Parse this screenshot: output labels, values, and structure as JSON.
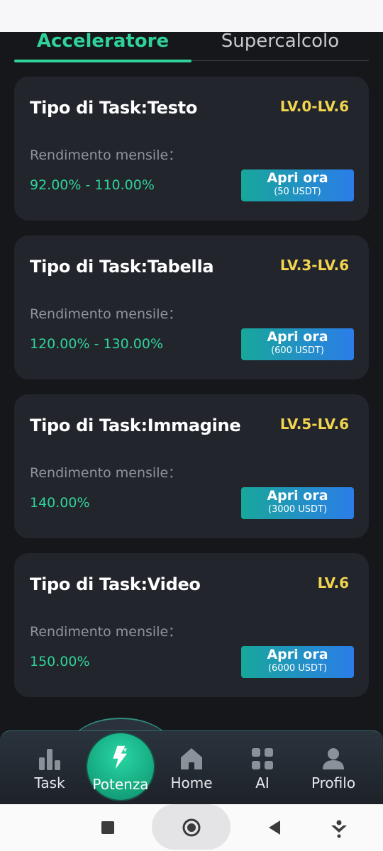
{
  "tabs": [
    {
      "label": "Acceleratore",
      "active": true
    },
    {
      "label": "Supercalcolo",
      "active": false
    }
  ],
  "cards": [
    {
      "title": "Tipo di Task:Testo",
      "level": "LV.0-LV.6",
      "label": "Rendimento mensile：",
      "yield": "92.00% - 110.00%",
      "button": "Apri ora",
      "price": "(50 USDT)"
    },
    {
      "title": "Tipo di Task:Tabella",
      "level": "LV.3-LV.6",
      "label": "Rendimento mensile：",
      "yield": "120.00% - 130.00%",
      "button": "Apri ora",
      "price": "(600 USDT)"
    },
    {
      "title": "Tipo di Task:Immagine",
      "level": "LV.5-LV.6",
      "label": "Rendimento mensile：",
      "yield": "140.00%",
      "button": "Apri ora",
      "price": "(3000 USDT)"
    },
    {
      "title": "Tipo di Task:Video",
      "level": "LV.6",
      "label": "Rendimento mensile：",
      "yield": "150.00%",
      "button": "Apri ora",
      "price": "(6000 USDT)"
    }
  ],
  "nav": {
    "task": {
      "label": "Task",
      "icon": "bar-chart-icon"
    },
    "potenza": {
      "label": "Potenza",
      "icon": "lightning-icon"
    },
    "home": {
      "label": "Home",
      "icon": "home-icon"
    },
    "ai": {
      "label": "AI",
      "icon": "grid-icon"
    },
    "profilo": {
      "label": "Profilo",
      "icon": "user-icon"
    }
  },
  "colors": {
    "accent": "#2fd39a",
    "level": "#f2d54e",
    "button_start": "#18a79b",
    "button_end": "#2b7de9",
    "card": "#23252d",
    "background": "#15171b"
  },
  "system_nav": [
    "recents-icon",
    "home-circle-icon",
    "back-icon",
    "assistant-icon"
  ]
}
